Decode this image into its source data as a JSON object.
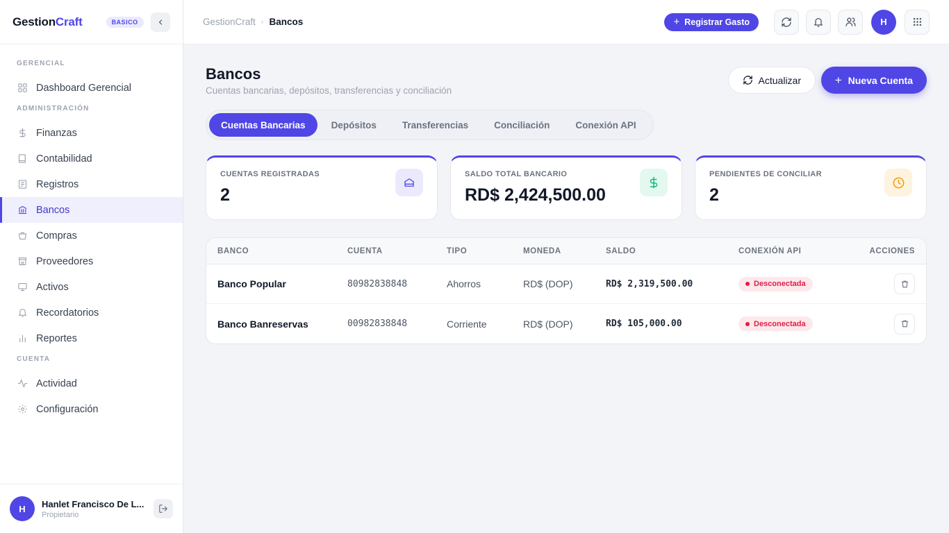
{
  "sidebar": {
    "brand_main": "Gestion",
    "brand_accent": "Craft",
    "plan_badge": "BASICO",
    "sections": {
      "gerencial": "GERENCIAL",
      "administracion": "ADMINISTRACIÓN",
      "cuenta": "CUENTA"
    },
    "items": {
      "dashboard": "Dashboard Gerencial",
      "finanzas": "Finanzas",
      "contabilidad": "Contabilidad",
      "registros": "Registros",
      "bancos": "Bancos",
      "compras": "Compras",
      "proveedores": "Proveedores",
      "activos": "Activos",
      "recordatorios": "Recordatorios",
      "reportes": "Reportes",
      "actividad": "Actividad",
      "configuracion": "Configuración"
    },
    "active_item": "bancos",
    "user": {
      "initial": "H",
      "name": "Hanlet Francisco De L...",
      "role": "Propietario"
    }
  },
  "topbar": {
    "breadcrumb_root": "GestionCraft",
    "breadcrumb_sep": "›",
    "breadcrumb_current": "Bancos",
    "register_expense": "Registrar Gasto",
    "avatar_initial": "H"
  },
  "page": {
    "title": "Bancos",
    "subtitle": "Cuentas bancarias, depósitos, transferencias y conciliación",
    "refresh_label": "Actualizar",
    "new_account_label": "Nueva Cuenta",
    "tabs": [
      "Cuentas Bancarias",
      "Depósitos",
      "Transferencias",
      "Conciliación",
      "Conexión API"
    ],
    "active_tab": 0
  },
  "stats": [
    {
      "label": "CUENTAS REGISTRADAS",
      "value": "2",
      "icon": "bank-icon"
    },
    {
      "label": "SALDO TOTAL BANCARIO",
      "value": "RD$ 2,424,500.00",
      "icon": "dollar-icon"
    },
    {
      "label": "PENDIENTES DE CONCILIAR",
      "value": "2",
      "icon": "clock-icon"
    }
  ],
  "table": {
    "headers": [
      "BANCO",
      "CUENTA",
      "TIPO",
      "MONEDA",
      "SALDO",
      "CONEXIÓN API",
      "ACCIONES"
    ],
    "rows": [
      {
        "banco": "Banco Popular",
        "cuenta": "80982838848",
        "tipo": "Ahorros",
        "moneda": "RD$ (DOP)",
        "saldo": "RD$ 2,319,500.00",
        "conexion": "Desconectada"
      },
      {
        "banco": "Banco Banreservas",
        "cuenta": "00982838848",
        "tipo": "Corriente",
        "moneda": "RD$ (DOP)",
        "saldo": "RD$ 105,000.00",
        "conexion": "Desconectada"
      }
    ]
  },
  "colors": {
    "accent": "#4f46e5",
    "danger": "#e11d48",
    "success": "#10b981",
    "warning": "#f59e0b"
  }
}
